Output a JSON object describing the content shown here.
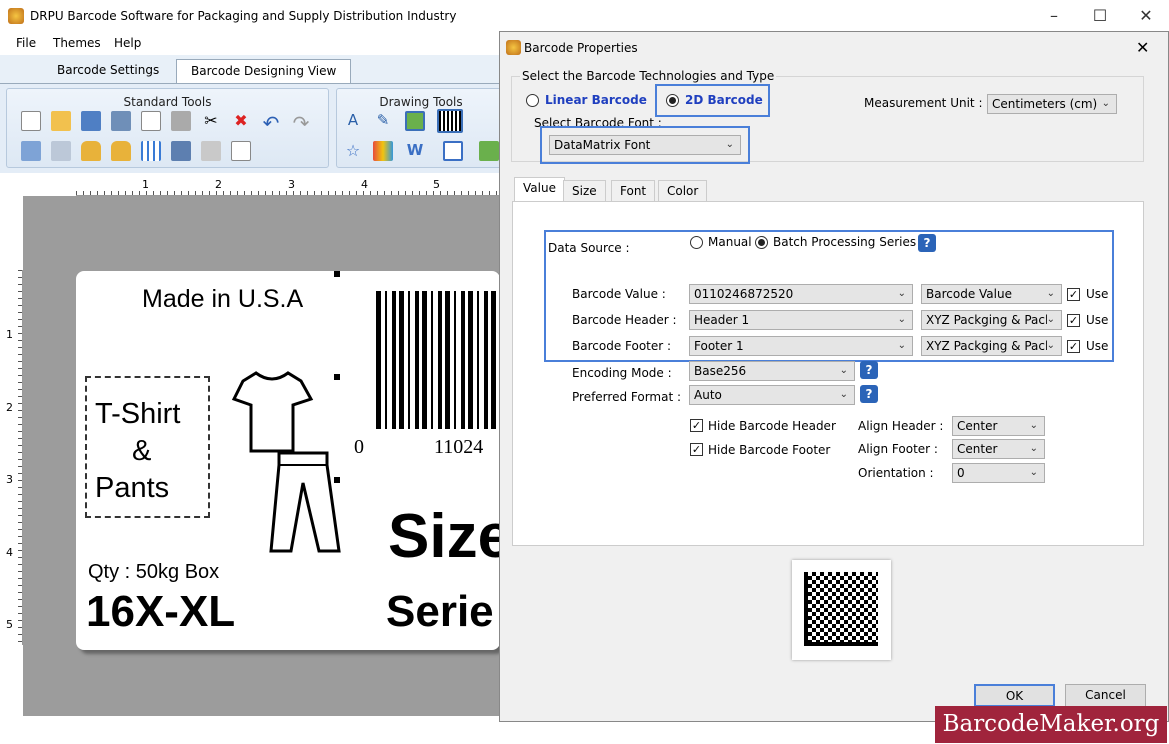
{
  "window": {
    "title": "DRPU Barcode Software for Packaging and Supply Distribution Industry"
  },
  "menu": {
    "file": "File",
    "themes": "Themes",
    "help": "Help"
  },
  "tabs": {
    "settings": "Barcode Settings",
    "designing": "Barcode Designing View"
  },
  "ribbon": {
    "standard_tools": "Standard Tools",
    "drawing_tools": "Drawing Tools"
  },
  "ruler": {
    "h": [
      "1",
      "2",
      "3",
      "4",
      "5"
    ],
    "v": [
      "1",
      "2",
      "3",
      "4",
      "5"
    ]
  },
  "label": {
    "made_in": "Made in U.S.A",
    "tshirt_line1": "T-Shirt",
    "tshirt_line2": "&",
    "tshirt_line3": "Pants",
    "qty": "Qty : 50kg Box",
    "size_code": "16X-XL",
    "barcode_digits_left": "0",
    "barcode_digits_right": "11024",
    "size_text": "Size",
    "series_text": "Serie"
  },
  "dialog": {
    "title": "Barcode Properties",
    "tech_group_label": "Select the Barcode Technologies and Type",
    "linear_label": "Linear Barcode",
    "twod_label": "2D Barcode",
    "font_label": "Select Barcode Font :",
    "font_value": "DataMatrix Font",
    "measurement_label": "Measurement Unit :",
    "measurement_value": "Centimeters (cm)",
    "tabs": [
      "Value",
      "Size",
      "Font",
      "Color"
    ],
    "data_source_label": "Data Source :",
    "manual_label": "Manual",
    "batch_label": "Batch Processing Series",
    "rows": [
      {
        "label": "Barcode Value :",
        "value": "0110246872520",
        "source": "Barcode Value",
        "use": "Use"
      },
      {
        "label": "Barcode Header :",
        "value": "Header 1",
        "source": "XYZ Packging & Pacl",
        "use": "Use"
      },
      {
        "label": "Barcode Footer :",
        "value": "Footer 1",
        "source": "XYZ Packging & Pacl",
        "use": "Use"
      }
    ],
    "encoding_label": "Encoding Mode :",
    "encoding_value": "Base256",
    "format_label": "Preferred Format :",
    "format_value": "Auto",
    "hide_header_label": "Hide Barcode Header",
    "hide_footer_label": "Hide Barcode Footer",
    "align_header_label": "Align Header :",
    "align_header_value": "Center",
    "align_footer_label": "Align Footer :",
    "align_footer_value": "Center",
    "orientation_label": "Orientation :",
    "orientation_value": "0",
    "ok_label": "OK",
    "cancel_label": "Cancel"
  },
  "watermark": "BarcodeMaker.org",
  "icons": [
    "app-icon",
    "new-icon",
    "open-icon",
    "save-icon",
    "print-icon",
    "copy-icon",
    "paste-icon",
    "cut-icon",
    "delete-icon",
    "undo-icon",
    "redo-icon",
    "help-icon",
    "close-icon",
    "minimize-icon",
    "maximize-icon"
  ]
}
